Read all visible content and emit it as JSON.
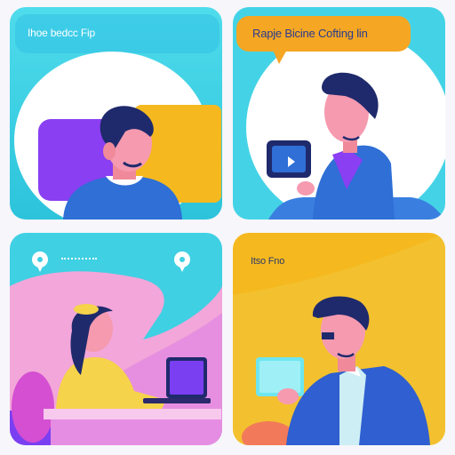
{
  "panels": [
    {
      "caption": "Ihoe bedcc Fip"
    },
    {
      "caption": "Rapje Bicine Cofting lin"
    },
    {
      "caption": ""
    },
    {
      "caption": "Itso Fno"
    }
  ],
  "colors": {
    "cyan": "#3fd0e3",
    "orange": "#f5a623",
    "purple": "#7b3ff2",
    "pink": "#f2a6d9",
    "blue": "#2f6fd6"
  },
  "icons": [
    "pin-icon",
    "pin-icon",
    "tablet-icon",
    "laptop-icon"
  ]
}
